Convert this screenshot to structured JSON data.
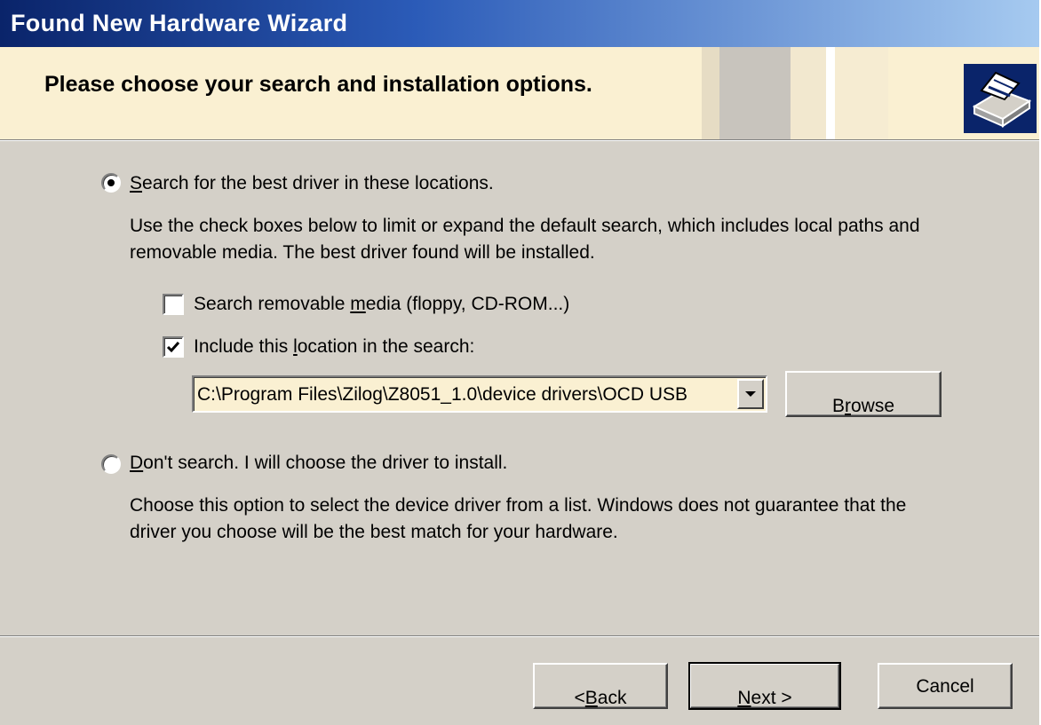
{
  "window": {
    "title": "Found New Hardware Wizard",
    "header_heading": "Please choose your search and installation options.",
    "badge_icon": "hardware-wizard-icon"
  },
  "option_search": {
    "accel": "S",
    "label_rest": "earch for the best driver in these locations.",
    "selected": true,
    "description_line1": "Use the check boxes below to limit or expand the default search, which includes local paths and",
    "description_line2": "removable media. The best driver found will be installed."
  },
  "checkbox_removable": {
    "label_pre": "Search removable ",
    "accel": "m",
    "label_post": "edia (floppy, CD-ROM...)",
    "checked": false
  },
  "checkbox_location": {
    "label_pre": "Include this ",
    "accel": "l",
    "label_post": "ocation in the search:",
    "checked": true
  },
  "location_combo": {
    "value": "C:\\Program Files\\Zilog\\Z8051_1.0\\device drivers\\OCD USB"
  },
  "browse_button": {
    "accel": "r",
    "pre": "B",
    "post": "owse"
  },
  "option_manual": {
    "accel": "D",
    "label_rest": "on't search. I will choose the driver to install.",
    "selected": false,
    "description_line1": "Choose this option to select the device driver from a list.  Windows does not guarantee that the",
    "description_line2": "driver you choose will be the best match for your hardware."
  },
  "footer": {
    "back": {
      "prefix": "< ",
      "accel": "B",
      "rest": "ack"
    },
    "next": {
      "accel": "N",
      "rest": "ext >"
    },
    "cancel": "Cancel"
  },
  "colors": {
    "title_start": "#0a246a",
    "title_end": "#a6caf0",
    "header_bg": "#faf0d2",
    "face": "#d4d0c8"
  }
}
